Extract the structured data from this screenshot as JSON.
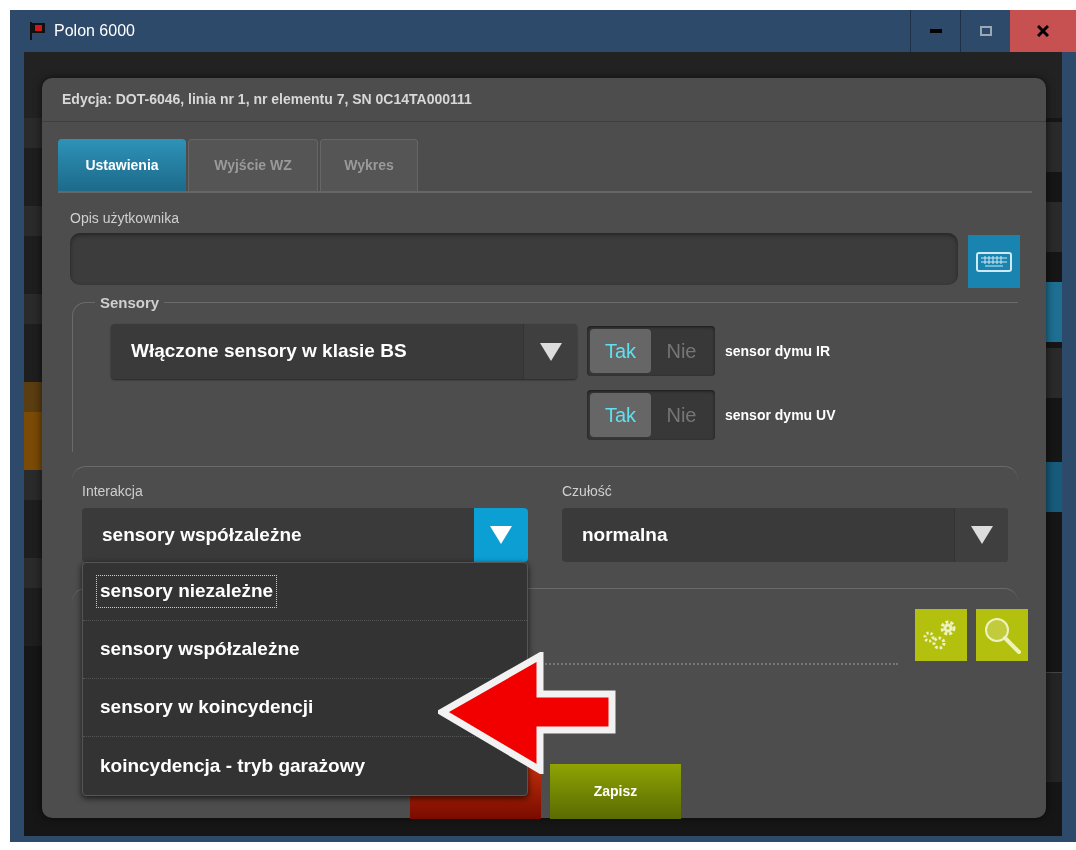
{
  "window": {
    "title": "Polon 6000"
  },
  "dialog": {
    "title": "Edycja: DOT-6046, linia nr 1, nr elementu 7, SN 0C14TA000111",
    "tabs": [
      {
        "label": "Ustawienia",
        "selected": true
      },
      {
        "label": "Wyjście WZ",
        "selected": false
      },
      {
        "label": "Wykres",
        "selected": false
      }
    ],
    "description": {
      "label": "Opis użytkownika"
    },
    "sensors": {
      "legend": "Sensory",
      "mode": "Włączone sensory w klasie BS",
      "toggles": [
        {
          "on_label": "Tak",
          "off_label": "Nie",
          "on": true,
          "label": "sensor dymu IR"
        },
        {
          "on_label": "Tak",
          "off_label": "Nie",
          "on": true,
          "label": "sensor dymu UV"
        }
      ]
    },
    "interaction": {
      "label": "Interakcja",
      "value": "sensory współzależne",
      "expanded": true,
      "options": [
        {
          "label": "sensory niezależne",
          "focused": true
        },
        {
          "label": "sensory współzależne",
          "focused": false
        },
        {
          "label": "sensory w koincydencji",
          "focused": false
        },
        {
          "label": "koincydencja - tryb garażowy",
          "focused": false
        }
      ]
    },
    "sensitivity": {
      "label": "Czułość",
      "value": "normalna"
    },
    "buttons": [
      {
        "kind": "cancel"
      },
      {
        "label": "Zapisz",
        "kind": "save"
      }
    ]
  }
}
